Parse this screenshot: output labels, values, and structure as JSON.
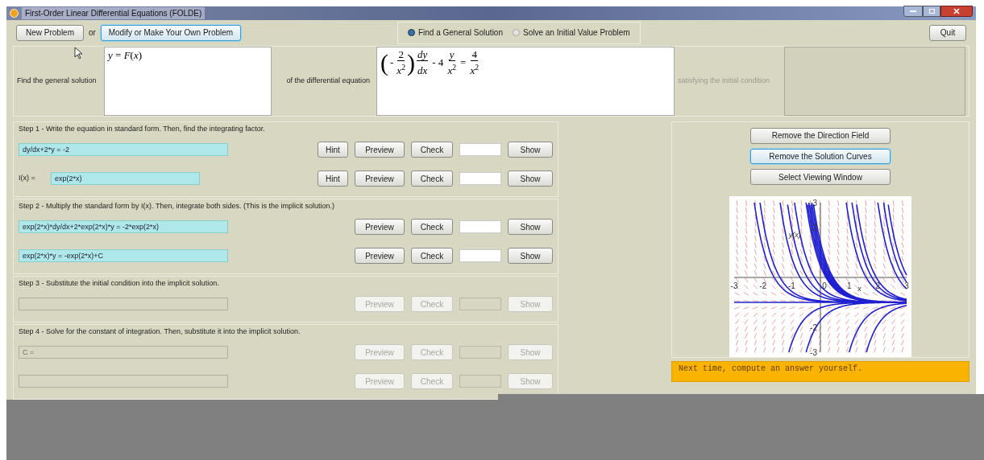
{
  "window": {
    "title": "First-Order Linear Differential Equations (FOLDE)"
  },
  "toolbar": {
    "new_button": "New Problem",
    "or_label": "or",
    "modify_button": "Modify or Make Your Own Problem",
    "quit_button": "Quit",
    "modes": [
      {
        "label": "Find a General Solution",
        "selected": true
      },
      {
        "label": "Solve an Initial Value Problem",
        "selected": false
      }
    ]
  },
  "problem": {
    "find_label": "Find the general solution",
    "solution_form": "*y* = *F*(*x*)",
    "equation_label": "of the differential equation",
    "equation": [
      {
        "kind": "paren",
        "open": "(",
        "close": ")",
        "sign": "-",
        "num": "2",
        "den": "*x*$^{2}$"
      },
      {
        "kind": "frac",
        "num": "*dy*",
        "den": "*dx*"
      },
      {
        "kind": "text",
        "text": "- 4"
      },
      {
        "kind": "frac",
        "num": "*y*",
        "den": "*x*$^{2}$"
      },
      {
        "kind": "text",
        "text": "="
      },
      {
        "kind": "frac",
        "num": "4",
        "den": "*x*$^{2}$"
      }
    ],
    "condition_label": "satisfying the initial condition",
    "condition_enabled": false
  },
  "steps": [
    {
      "title": "Step 1 - Write the equation in standard form. Then, find the integrating factor.",
      "rows": [
        {
          "value": "dy/dx+2*y = -2",
          "enabled": true,
          "buttons": [
            "Hint",
            "Preview",
            "Check",
            "Show"
          ]
        },
        {
          "label": "I(x) =",
          "value": "exp(2*x)",
          "enabled": true,
          "buttons": [
            "Hint",
            "Preview",
            "Check",
            "Show"
          ]
        }
      ]
    },
    {
      "title": "Step 2 - Multiply the standard form by I(x). Then, integrate both sides. (This is the implicit solution.)",
      "rows": [
        {
          "value": "exp(2*x)*dy/dx+2*exp(2*x)*y = -2*exp(2*x)",
          "enabled": true,
          "buttons": [
            "Preview",
            "Check",
            "Show"
          ]
        },
        {
          "value": "exp(2*x)*y = -exp(2*x)+C",
          "enabled": true,
          "buttons": [
            "Preview",
            "Check",
            "Show"
          ]
        }
      ]
    },
    {
      "title": "Step 3 - Substitute the initial condition into the implicit solution.",
      "rows": [
        {
          "enabled": false,
          "buttons": [
            "Preview",
            "Check",
            "Show"
          ]
        }
      ]
    },
    {
      "title": "Step 4 - Solve for the constant of integration. Then, substitute it into the implicit solution.",
      "rows": [
        {
          "value": "C =",
          "enabled": false,
          "buttons": [
            "Preview",
            "Check",
            "Show"
          ]
        },
        {
          "enabled": false,
          "buttons": [
            "Preview",
            "Check",
            "Show"
          ]
        }
      ]
    }
  ],
  "plot_panel": {
    "buttons": [
      {
        "label": "Remove the Direction Field",
        "focused": false
      },
      {
        "label": "Remove the Solution Curves",
        "focused": true
      },
      {
        "label": "Select Viewing Window",
        "focused": false
      }
    ],
    "x_ticks": [
      "-3",
      "-2",
      "-1",
      "0",
      "1",
      "2",
      "3"
    ],
    "y_ticks": [
      "3",
      "2",
      "-2",
      "-3"
    ],
    "x_label": "x",
    "y_label": "y(x)"
  },
  "message": "Next time, compute an answer yourself."
}
